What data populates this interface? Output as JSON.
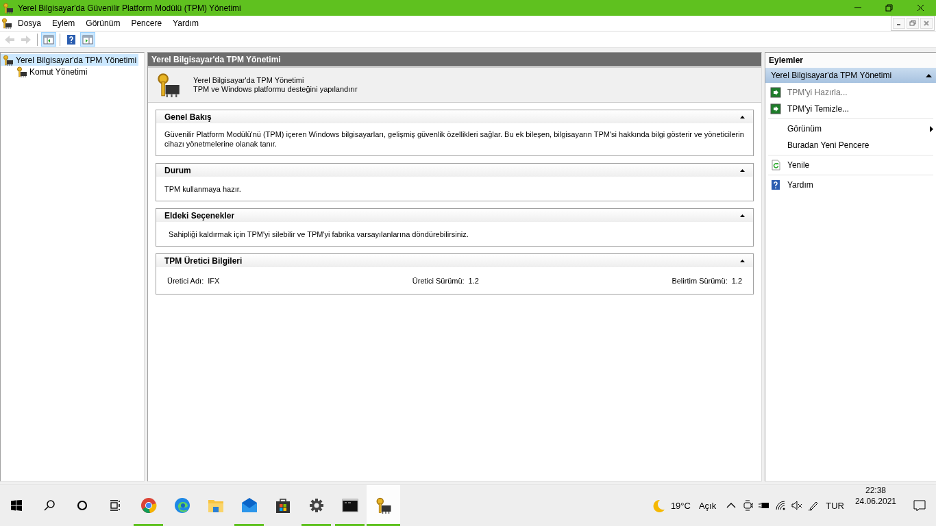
{
  "window": {
    "title": "Yerel Bilgisayar'da Güvenilir Platform Modülü (TPM) Yönetimi"
  },
  "menu": [
    "Dosya",
    "Eylem",
    "Görünüm",
    "Pencere",
    "Yardım"
  ],
  "toolbar": [
    {
      "kind": "back",
      "disabled": true,
      "pressed": false
    },
    {
      "kind": "forward",
      "disabled": true,
      "pressed": false
    },
    {
      "kind": "tree-toggle",
      "disabled": false,
      "pressed": true
    },
    {
      "kind": "help",
      "disabled": false,
      "pressed": false
    },
    {
      "kind": "action-toggle",
      "disabled": false,
      "pressed": true
    }
  ],
  "tree": [
    {
      "label": "Yerel Bilgisayar'da TPM Yönetimi",
      "selected": true,
      "children": [
        {
          "label": "Komut Yönetimi",
          "selected": false
        }
      ]
    }
  ],
  "content": {
    "header": "Yerel Bilgisayar'da TPM Yönetimi",
    "intro": {
      "title": "Yerel Bilgisayar'da TPM Yönetimi",
      "subtitle": "TPM ve Windows platformu desteğini yapılandırır"
    },
    "sections": [
      {
        "title": "Genel Bakış",
        "expanded": true,
        "kind": "text",
        "text": "Güvenilir Platform Modülü'nü (TPM) içeren Windows bilgisayarları, gelişmiş güvenlik özellikleri sağlar. Bu ek bileşen, bilgisayarın TPM'si hakkında bilgi gösterir ve yöneticilerin cihazı yönetmelerine olanak tanır."
      },
      {
        "title": "Durum",
        "expanded": true,
        "kind": "text",
        "text": "TPM kullanmaya hazır."
      },
      {
        "title": "Eldeki Seçenekler",
        "expanded": true,
        "kind": "text",
        "text": "Sahipliği kaldırmak için TPM'yi silebilir ve TPM'yi fabrika varsayılanlarına döndürebilirsiniz."
      },
      {
        "title": "TPM Üretici Bilgileri",
        "expanded": true,
        "kind": "fields",
        "fields": [
          {
            "label": "Üretici Adı:",
            "value": "IFX"
          },
          {
            "label": "Üretici Sürümü:",
            "value": "1.2"
          },
          {
            "label": "Belirtim Sürümü:",
            "value": "1.2"
          }
        ]
      }
    ]
  },
  "actions": {
    "title": "Eylemler",
    "group": {
      "label": "Yerel Bilgisayar'da TPM Yönetimi",
      "expanded": true
    },
    "item_groups": [
      {
        "items": [
          {
            "label": "TPM'yi Hazırla...",
            "kind": "run",
            "disabled": true,
            "submenu": false
          },
          {
            "label": "TPM'yi Temizle...",
            "kind": "run",
            "disabled": false,
            "submenu": false
          }
        ]
      },
      {
        "items": [
          {
            "label": "Görünüm",
            "kind": "plain",
            "disabled": false,
            "submenu": true
          },
          {
            "label": "Buradan Yeni Pencere",
            "kind": "plain",
            "disabled": false,
            "submenu": false
          }
        ]
      },
      {
        "items": [
          {
            "label": "Yenile",
            "kind": "refresh",
            "disabled": false,
            "submenu": false
          }
        ]
      },
      {
        "items": [
          {
            "label": "Yardım",
            "kind": "help",
            "disabled": false,
            "submenu": false
          }
        ]
      }
    ]
  },
  "taskbar": {
    "apps": [
      {
        "kind": "browser",
        "running": true,
        "active": false
      },
      {
        "kind": "edge",
        "running": false,
        "active": false
      },
      {
        "kind": "folder",
        "running": false,
        "active": false
      },
      {
        "kind": "mail",
        "running": true,
        "active": false
      },
      {
        "kind": "store",
        "running": false,
        "active": false
      },
      {
        "kind": "settings",
        "running": true,
        "active": false
      },
      {
        "kind": "terminal",
        "running": true,
        "active": false
      },
      {
        "kind": "tpm",
        "running": true,
        "active": true
      }
    ],
    "weather": {
      "temperature": "19°C",
      "condition": "Açık"
    },
    "language": "TUR",
    "time": "22:38",
    "date": "24.06.2021"
  }
}
